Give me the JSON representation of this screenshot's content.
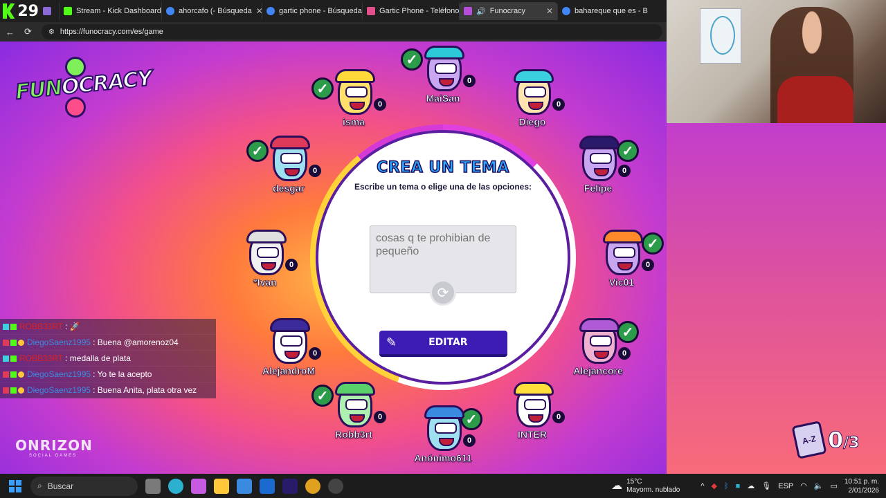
{
  "browser": {
    "kick_counter": "29",
    "tabs": [
      {
        "label": "",
        "icon": "generic-tab-icon",
        "color": "#8a6bd6"
      },
      {
        "label": "Stream - Kick Dashboard",
        "icon": "kick-icon",
        "color": "#53fc18"
      },
      {
        "label": "ahorcafo (- Búsqueda",
        "icon": "search-icon",
        "color": "#4285f4"
      },
      {
        "label": "gartic phone - Búsqueda",
        "icon": "search-icon",
        "color": "#4285f4"
      },
      {
        "label": "Gartic Phone - Teléfono ..",
        "icon": "gartic-icon",
        "color": "#e0508a"
      },
      {
        "label": "Funocracy",
        "icon": "funocracy-icon",
        "color": "#b44fd6"
      },
      {
        "label": "bahareque que es - Búsq",
        "icon": "search-icon",
        "color": "#4285f4"
      }
    ],
    "url": "https://funocracy.com/es/game"
  },
  "game": {
    "logo_fun": "FUN",
    "logo_rest": "OCRACY",
    "title": "CREA UN TEMA",
    "subtitle": "Escribe un tema o elige una de las opciones:",
    "input_value": "cosas q te prohibian de pequeño",
    "edit_button": "EDITAR",
    "round_current": "0",
    "round_total": "/3",
    "round_icon_label": "A-Z",
    "footer_brand": "ONRIZON",
    "footer_tag": "SOCIAL GAMES",
    "players": [
      {
        "name": "MaiSan",
        "score": "0",
        "ready": true,
        "skin": "#c8a6f0",
        "hair": "#2ec9d9"
      },
      {
        "name": "isma",
        "score": "0",
        "ready": true,
        "skin": "#ffe06a",
        "hair": "#ffd83a"
      },
      {
        "name": "Diego",
        "score": "0",
        "ready": false,
        "skin": "#ffe4b0",
        "hair": "#3ad0e0"
      },
      {
        "name": "desgar",
        "score": "0",
        "ready": true,
        "skin": "#9ee0f0",
        "hair": "#e03a5a"
      },
      {
        "name": "Felipe",
        "score": "0",
        "ready": true,
        "skin": "#c8a6f0",
        "hair": "#2a1a6a"
      },
      {
        "name": "*Ivan",
        "score": "0",
        "ready": false,
        "skin": "#f0f0f0",
        "hair": "#e0e0e0"
      },
      {
        "name": "Vic01",
        "score": "0",
        "ready": true,
        "skin": "#c8a6f0",
        "hair": "#ff8a2a"
      },
      {
        "name": "AlejandroM",
        "score": "0",
        "ready": false,
        "skin": "#ffffff",
        "hair": "#3a2a9a"
      },
      {
        "name": "Alejancore",
        "score": "0",
        "ready": true,
        "skin": "#f0b0d0",
        "hair": "#b05ad6"
      },
      {
        "name": "Robb3rt",
        "score": "0",
        "ready": true,
        "skin": "#aef0b0",
        "hair": "#5ad06a"
      },
      {
        "name": "Anónimo611",
        "score": "0",
        "ready": true,
        "skin": "#9ee0f0",
        "hair": "#3a8ae0"
      },
      {
        "name": "INTER",
        "score": "0",
        "ready": false,
        "skin": "#ffffff",
        "hair": "#ffe03a"
      }
    ]
  },
  "chat": [
    {
      "user": "ROBB33RT",
      "user_color": "#e02020",
      "message": ": 🚀"
    },
    {
      "user": "DiegoSaenz1995",
      "user_color": "#3a8ae0",
      "message": ": Buena @amorenoz04"
    },
    {
      "user": "ROBB33RT",
      "user_color": "#e02020",
      "message": ": medalla de plata"
    },
    {
      "user": "DiegoSaenz1995",
      "user_color": "#3a8ae0",
      "message": ": Yo te la acepto"
    },
    {
      "user": "DiegoSaenz1995",
      "user_color": "#3a8ae0",
      "message": ": Buena Anita, plata otra vez"
    }
  ],
  "taskbar": {
    "search_placeholder": "Buscar",
    "weather_temp": "15°C",
    "weather_desc": "Mayorm. nublado",
    "weather_alert": "1",
    "lang": "ESP",
    "time": "10:51 p. m.",
    "date": "2/01/2026",
    "pinned": [
      {
        "icon": "task-view-icon",
        "color": "#7a7a7a"
      },
      {
        "icon": "edge-icon",
        "color": "#2bb0d0"
      },
      {
        "icon": "copilot-icon",
        "color": "#c65ae0"
      },
      {
        "icon": "file-explorer-icon",
        "color": "#ffc83a"
      },
      {
        "icon": "store-icon",
        "color": "#3a8ae0"
      },
      {
        "icon": "outlook-icon",
        "color": "#1a6ad0"
      },
      {
        "icon": "premiere-icon",
        "color": "#2a1a6a"
      },
      {
        "icon": "chrome-icon",
        "color": "#e0a020"
      },
      {
        "icon": "obs-icon",
        "color": "#444444"
      }
    ]
  }
}
